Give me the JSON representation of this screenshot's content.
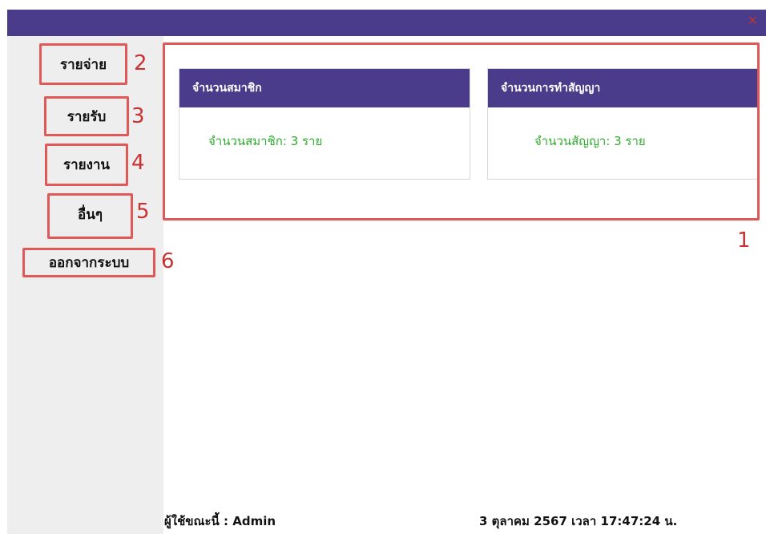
{
  "window": {
    "close_icon": "close-icon",
    "close_glyph": "✕"
  },
  "sidebar": {
    "items": [
      {
        "label": "รายจ่าย"
      },
      {
        "label": "รายรับ"
      },
      {
        "label": "รายงาน"
      },
      {
        "label": "อื่นๆ"
      },
      {
        "label": "ออกจากระบบ"
      }
    ]
  },
  "annotations": {
    "region_number": "1",
    "item_numbers": [
      "2",
      "3",
      "4",
      "5",
      "6"
    ]
  },
  "cards": [
    {
      "title": "จำนวนสมาชิก",
      "value": "จำนวนสมาชิก: 3 ราย"
    },
    {
      "title": "จำนวนการทำสัญญา",
      "value": "จำนวนสัญญา: 3 ราย"
    }
  ],
  "footer": {
    "user": "ผู้ใช้ขณะนี้ : Admin",
    "datetime": "3 ตุลาคม 2567 เวลา 17:47:24 น."
  },
  "colors": {
    "header_purple": "#4a3b8b",
    "annotation_red": "#e05858",
    "value_green": "#2eaa2e"
  }
}
